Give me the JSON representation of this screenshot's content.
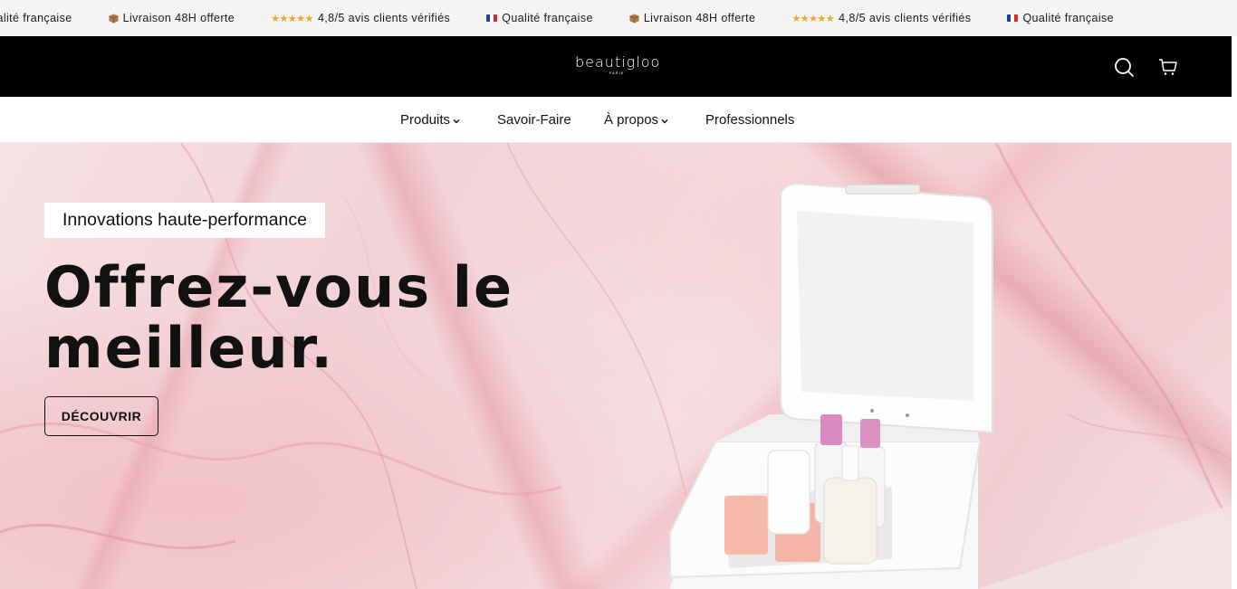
{
  "announcement": {
    "items": [
      {
        "icon": "flag-fr-icon",
        "text": "Qualité française"
      },
      {
        "icon": "box-icon",
        "text": "Livraison 48H offerte"
      },
      {
        "icon": "stars-icon",
        "stars": "★★★★★",
        "text": "4,8/5 avis clients vérifiés"
      },
      {
        "icon": "flag-fr-icon",
        "text": "Qualité française"
      },
      {
        "icon": "box-icon",
        "text": "Livraison 48H offerte"
      },
      {
        "icon": "stars-icon",
        "stars": "★★★★★",
        "text": "4,8/5 avis clients vérifiés"
      },
      {
        "icon": "flag-fr-icon",
        "text": "Qualité française"
      }
    ]
  },
  "header": {
    "logo_main": "beautigloo",
    "logo_sub": "PARIS",
    "search_icon": "search-icon",
    "cart_icon": "cart-icon"
  },
  "nav": {
    "items": [
      {
        "label": "Produits",
        "has_dropdown": true
      },
      {
        "label": "Savoir-Faire",
        "has_dropdown": false
      },
      {
        "label": "À propos",
        "has_dropdown": true
      },
      {
        "label": "Professionnels",
        "has_dropdown": false
      }
    ]
  },
  "hero": {
    "tagline": "Innovations haute-performance",
    "headline_line1": "Offrez-vous le",
    "headline_line2": "meilleur.",
    "cta_label": "DÉCOUVRIR"
  },
  "colors": {
    "header_bg": "#000000",
    "announce_bg": "#f4f4f4",
    "star": "#f4a521",
    "hero_pink": "#f2d2d6"
  }
}
